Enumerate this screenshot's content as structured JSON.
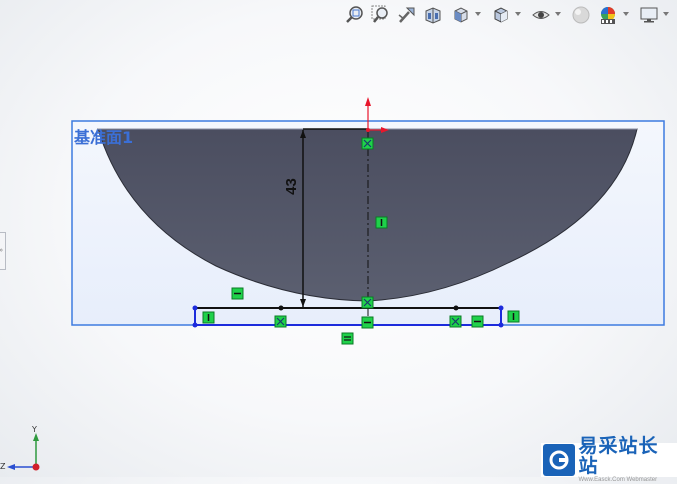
{
  "toolbar": {
    "items": [
      {
        "name": "zoom-to-fit-icon",
        "dropdown": false
      },
      {
        "name": "zoom-to-area-icon",
        "dropdown": false
      },
      {
        "name": "previous-view-icon",
        "dropdown": false
      },
      {
        "name": "section-view-icon",
        "dropdown": false
      },
      {
        "name": "view-orientation-icon",
        "dropdown": true
      },
      {
        "name": "display-style-icon",
        "dropdown": true
      },
      {
        "name": "hide-show-items-icon",
        "dropdown": true
      },
      {
        "name": "edit-appearance-icon",
        "dropdown": false
      },
      {
        "name": "apply-scene-icon",
        "dropdown": true
      },
      {
        "name": "view-settings-icon",
        "dropdown": true
      }
    ]
  },
  "sketch": {
    "plane_label": "基准面1",
    "dimension_value": "43",
    "colors": {
      "face": "#4d5163",
      "plane_border": "#3d7be0",
      "selected": "#1c2bdc",
      "relation": "#1fd14a",
      "origin_arrow": "#e8162c"
    }
  },
  "triad": {
    "y_label": "Y",
    "z_label": "Z"
  },
  "side_tab": {
    "label": "»"
  },
  "watermark": {
    "brand": "易采站长站",
    "url": "Www.Easck.Com  Webmaster"
  }
}
